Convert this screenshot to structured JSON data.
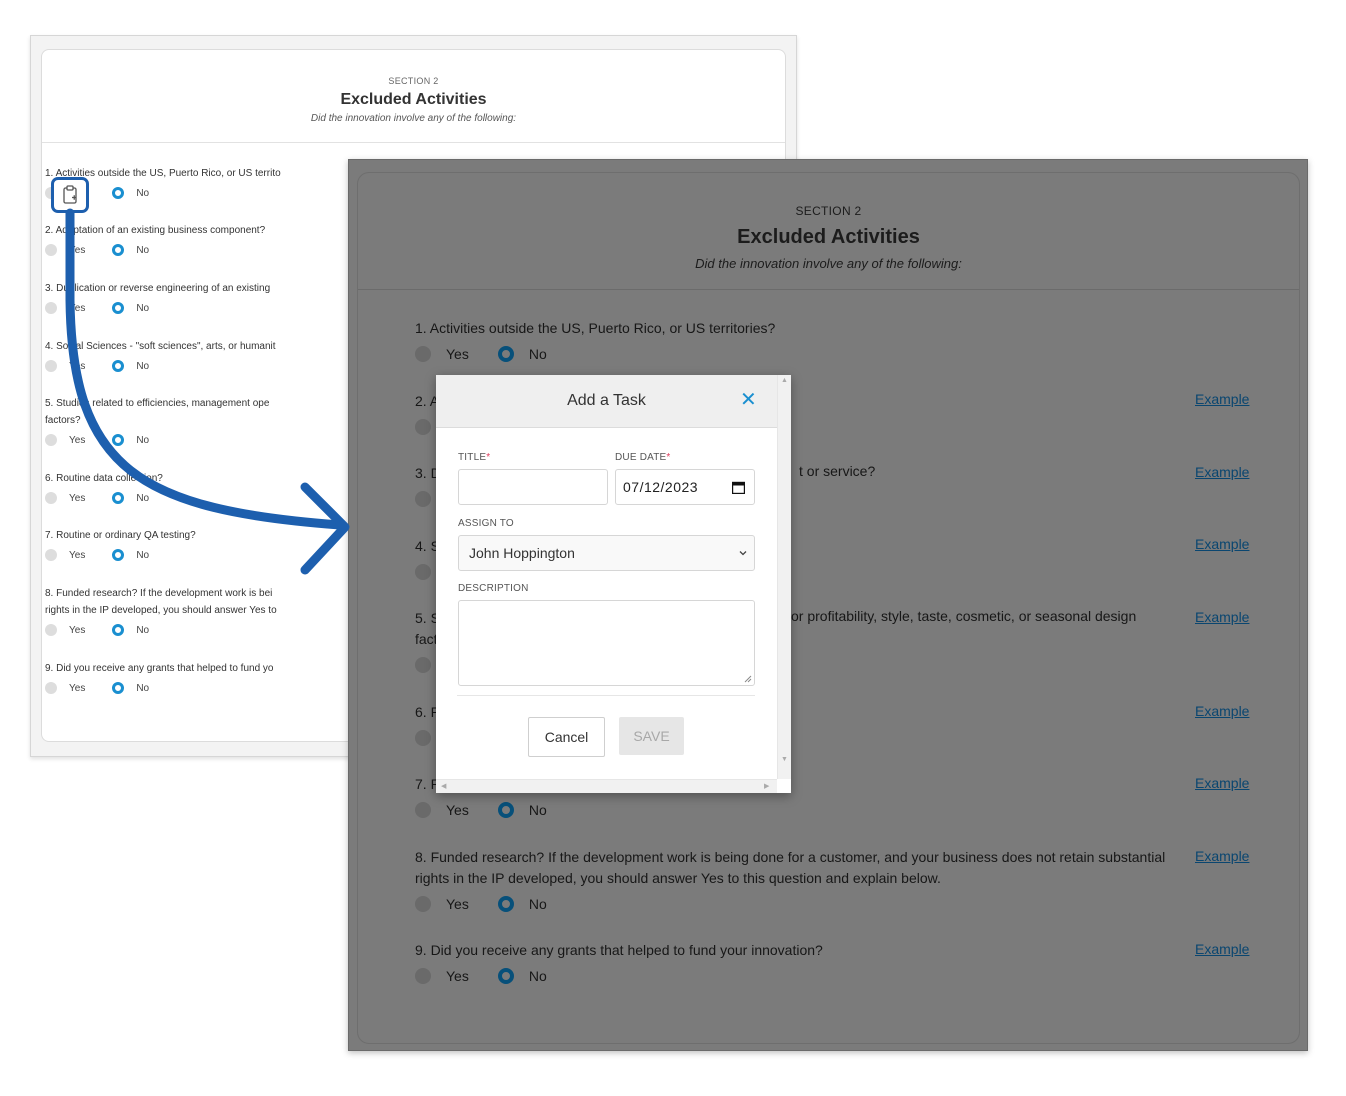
{
  "section": {
    "label": "SECTION 2",
    "title": "Excluded Activities",
    "subtitle": "Did the innovation involve any of the following:"
  },
  "options": {
    "yes": "Yes",
    "no": "No"
  },
  "background_questions": [
    "1. Activities outside the US, Puerto Rico, or US territo",
    "2. Adaptation of an existing business component?",
    "3. Duplication or reverse engineering of an existing",
    "4. Social Sciences - \"soft sciences\", arts, or humanit",
    "5. Studies related to efficiencies, management ope",
    "factors?",
    "6. Routine data collection?",
    "7. Routine or ordinary QA testing?",
    "8. Funded research? If the development work is bei",
    "rights in the IP developed, you should answer Yes to",
    "9. Did you receive any grants that helped to fund yo"
  ],
  "questions": [
    {
      "text": "1. Activities outside the US, Puerto Rico, or US territories?"
    },
    {
      "text": "2. A",
      "example": "Example"
    },
    {
      "text": "3. D",
      "tail": "t or service?",
      "example": "Example"
    },
    {
      "text": "4. S",
      "example": "Example"
    },
    {
      "text": "5. S",
      "tail": "or profitability, style, taste, cosmetic, or seasonal design",
      "cont": "fact",
      "example": "Example"
    },
    {
      "text": "6. R",
      "example": "Example"
    },
    {
      "text": "7. R",
      "example": "Example"
    },
    {
      "text": "8. Funded research? If the development work is being done for a customer, and your business does not retain substantial",
      "cont": "rights in the IP developed, you should answer Yes to this question and explain below.",
      "example": "Example"
    },
    {
      "text": "9. Did you receive any grants that helped to fund your innovation?",
      "example": "Example"
    }
  ],
  "modal": {
    "title": "Add a Task",
    "close_glyph": "✕",
    "title_label": "TITLE",
    "required_mark": "*",
    "due_label": "DUE DATE",
    "due_value": "07/12/2023",
    "title_value": "",
    "assign_label": "ASSIGN TO",
    "assign_value": "John Hoppington",
    "description_label": "DESCRIPTION",
    "description_value": "",
    "cancel_label": "Cancel",
    "save_label": "SAVE"
  },
  "colors": {
    "accent": "#1a8fd0",
    "highlight_arrow": "#1d5fae",
    "overlay": "#7b7b7b",
    "required": "#e0395a"
  },
  "icons": [
    "clipboard-plus-icon",
    "close-icon",
    "calendar-icon",
    "chevron-down-icon",
    "curved-arrow"
  ]
}
